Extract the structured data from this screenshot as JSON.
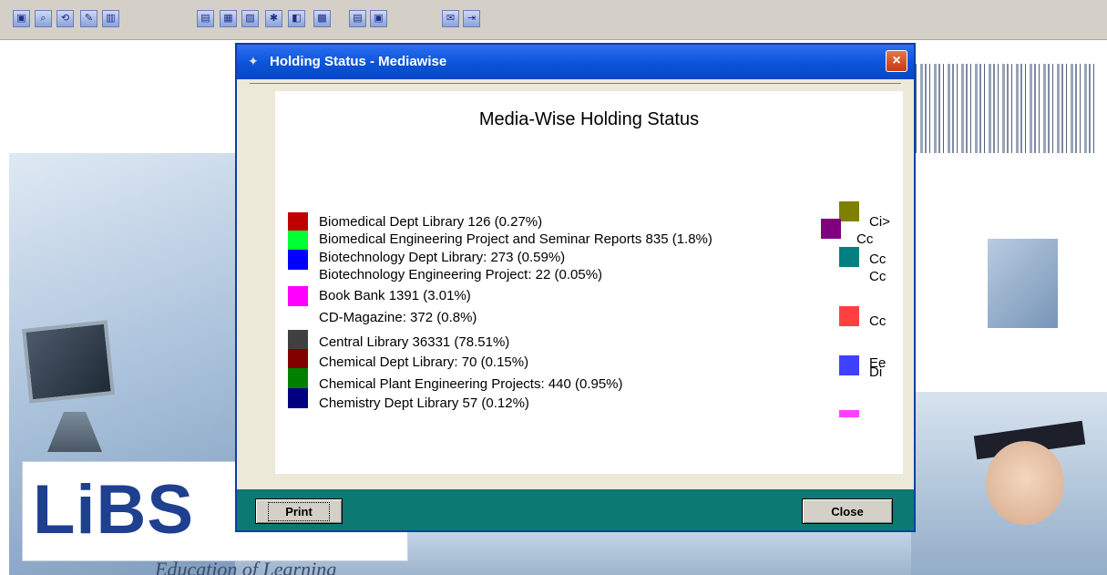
{
  "toolbar": {
    "icons": [
      "new-icon",
      "find-icon",
      "refresh-icon",
      "tools-icon",
      "catalog-icon",
      "transfer-icon",
      "report-icon",
      "edit-icon",
      "members-icon",
      "circulation-icon",
      "image-icon",
      "book-icon",
      "window-icon",
      "barcode-icon",
      "exit-icon"
    ]
  },
  "background": {
    "logo_text": "LiBS",
    "tagline": "Education of Learning"
  },
  "dialog": {
    "title": "Holding Status - Mediawise",
    "close_glyph": "×",
    "chart_title": "Media-Wise Holding Status",
    "buttons": {
      "print": "Print",
      "close": "Close"
    }
  },
  "chart_data": {
    "type": "pie",
    "title": "Media-Wise Holding Status",
    "legend": "right",
    "entries": [
      {
        "label": "Biomedical Dept Library 126 (0.27%)",
        "value": 126,
        "percent": 0.27,
        "color": "#c00000"
      },
      {
        "label": "Biomedical Engineering Project and Seminar Reports 835 (1.8%)",
        "value": 835,
        "percent": 1.8,
        "color": "#00ff33"
      },
      {
        "label": "Biotechnology Dept Library: 273 (0.59%)",
        "value": 273,
        "percent": 0.59,
        "color": "#0000ff"
      },
      {
        "label": "Biotechnology Engineering Project: 22 (0.05%)",
        "value": 22,
        "percent": 0.05,
        "color": ""
      },
      {
        "label": "Book Bank 1391 (3.01%)",
        "value": 1391,
        "percent": 3.01,
        "color": "#ff00ff"
      },
      {
        "label": "CD-Magazine: 372 (0.8%)",
        "value": 372,
        "percent": 0.8,
        "color": ""
      },
      {
        "label": "Central Library 36331 (78.51%)",
        "value": 36331,
        "percent": 78.51,
        "color": "#404040"
      },
      {
        "label": "Chemical Dept Library: 70 (0.15%)",
        "value": 70,
        "percent": 0.15,
        "color": "#800000"
      },
      {
        "label": "Chemical Plant Engineering Projects: 440 (0.95%)",
        "value": 440,
        "percent": 0.95,
        "color": "#008000"
      },
      {
        "label": "Chemistry Dept Library 57 (0.12%)",
        "value": 57,
        "percent": 0.12,
        "color": "#000080"
      }
    ],
    "right_column": [
      {
        "label": "Ci>",
        "color": "#808000"
      },
      {
        "label": "Cc",
        "color": "#800080"
      },
      {
        "label": "Cc",
        "color": "#008080"
      },
      {
        "label": "Cc",
        "color": ""
      },
      {
        "label": "Cc",
        "color": "#ff4040"
      },
      {
        "label": "Ee",
        "color": "#4040ff"
      },
      {
        "label": "Di",
        "color": ""
      },
      {
        "label": "",
        "color": "#ff40ff"
      }
    ]
  }
}
